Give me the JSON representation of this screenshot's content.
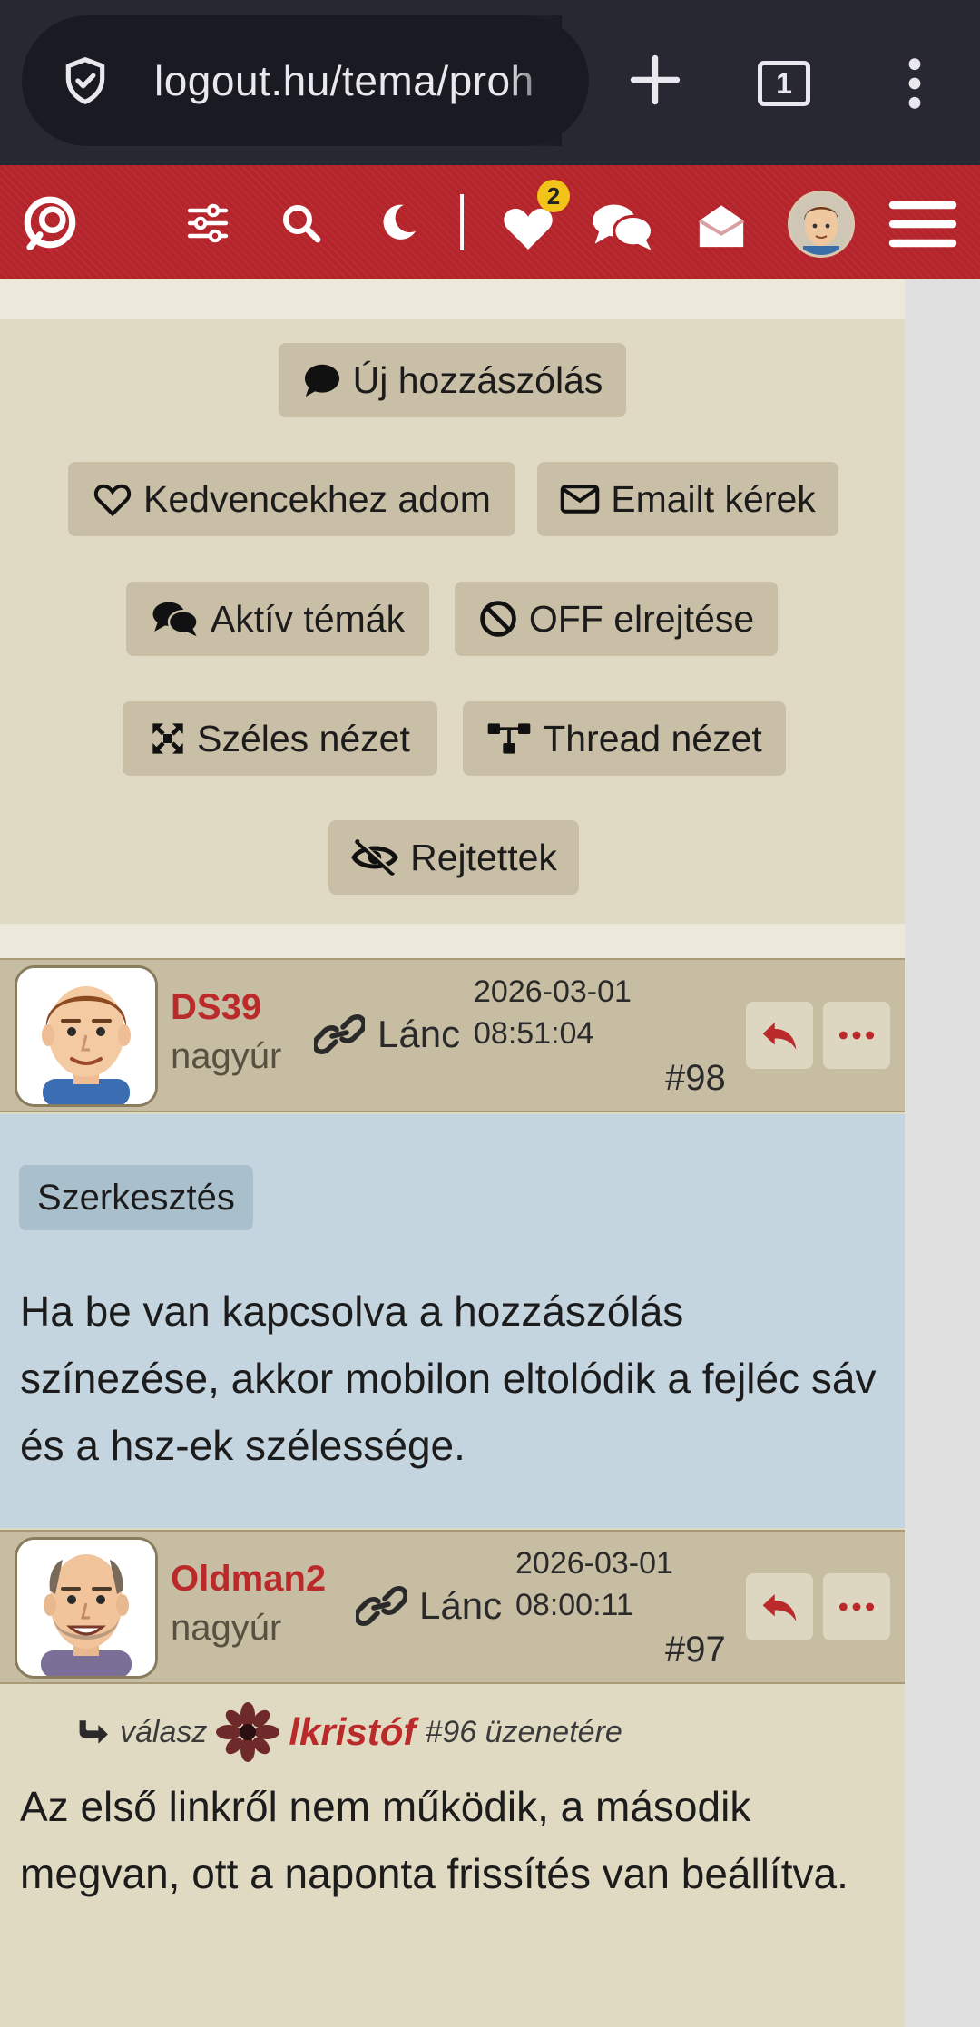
{
  "browser": {
    "url": "logout.hu/tema/proh",
    "tab_count": "1"
  },
  "header": {
    "favorites_badge": "2"
  },
  "actions": {
    "new_post": "Új hozzászólás",
    "add_favorite": "Kedvencekhez adom",
    "email_request": "Emailt kérek",
    "active_topics": "Aktív témák",
    "hide_off": "OFF elrejtése",
    "wide_view": "Széles nézet",
    "thread_view": "Thread nézet",
    "hidden": "Rejtettek"
  },
  "posts": [
    {
      "username": "DS39",
      "rank": "nagyúr",
      "chain_label": "Lánc",
      "date": "2026-03-01",
      "time": "08:51:04",
      "number": "#98",
      "edit_label": "Szerkesztés",
      "text": "Ha be van kapcsolva a hozzászólás színezése, akkor mobilon eltolódik a fejléc sáv és a hsz-ek szélessége."
    },
    {
      "username": "Oldman2",
      "rank": "nagyúr",
      "chain_label": "Lánc",
      "date": "2026-03-01",
      "time": "08:00:11",
      "number": "#97",
      "reply_prefix": "válasz",
      "reply_user": "lkristóf",
      "reply_suffix": "#96 üzenetére",
      "text": "Az első linkről nem működik, a második megvan, ott a naponta frissítés van beállítva."
    }
  ],
  "colors": {
    "header_red": "#b4242a",
    "username_red": "#bb2a2a",
    "badge_yellow": "#f2c318",
    "panel_beige": "#e0dac4",
    "button_beige": "#c9bfa6",
    "highlight_blue": "#c4d5df"
  }
}
